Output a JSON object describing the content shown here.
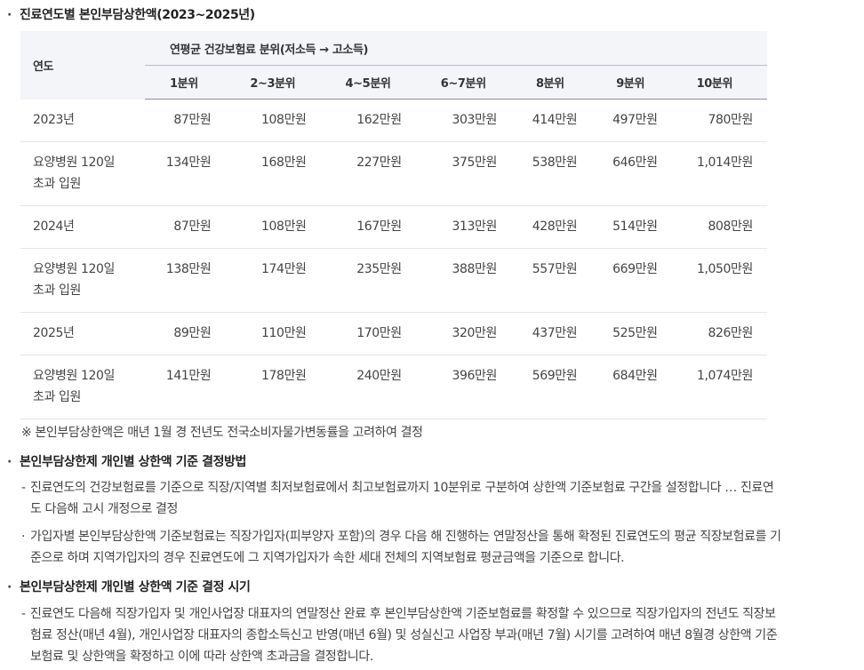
{
  "section1": {
    "bullet": "·",
    "title": "진료연도별 본인부담상한액(2023~2025년)"
  },
  "table": {
    "year_header": "연도",
    "group_header": "연평균 건강보험료 분위(저소득 → 고소득)",
    "columns": [
      "1분위",
      "2~3분위",
      "4~5분위",
      "6~7분위",
      "8분위",
      "9분위",
      "10분위"
    ],
    "rows": [
      {
        "label": [
          "2023년"
        ],
        "values": [
          "87만원",
          "108만원",
          "162만원",
          "303만원",
          "414만원",
          "497만원",
          "780만원"
        ]
      },
      {
        "label": [
          "요양병원 120일",
          "초과 입원"
        ],
        "values": [
          "134만원",
          "168만원",
          "227만원",
          "375만원",
          "538만원",
          "646만원",
          "1,014만원"
        ]
      },
      {
        "label": [
          "2024년"
        ],
        "values": [
          "87만원",
          "108만원",
          "167만원",
          "313만원",
          "428만원",
          "514만원",
          "808만원"
        ]
      },
      {
        "label": [
          "요양병원 120일",
          "초과 입원"
        ],
        "values": [
          "138만원",
          "174만원",
          "235만원",
          "388만원",
          "557만원",
          "669만원",
          "1,050만원"
        ]
      },
      {
        "label": [
          "2025년"
        ],
        "values": [
          "89만원",
          "110만원",
          "170만원",
          "320만원",
          "437만원",
          "525만원",
          "826만원"
        ]
      },
      {
        "label": [
          "요양병원 120일",
          "초과 입원"
        ],
        "values": [
          "141만원",
          "178만원",
          "240만원",
          "396만원",
          "569만원",
          "684만원",
          "1,074만원"
        ]
      }
    ]
  },
  "note": "※ 본인부담상한액은 매년 1월 경 전년도 전국소비자물가변동률을 고려하여 결정",
  "section2": {
    "bullet": "·",
    "title": "본인부담상한제 개인별 상한액 기준 결정방법",
    "para1": {
      "mark": "-",
      "line1": "진료연도의 건강보험료를 기준으로 직장/지역별 최저보험료에서 최고보험료까지 10분위로 구분하여 상한액 기준보험료 구간을 설정합니다 … 진료연",
      "line2": "도 다음해 고시 개정으로 결정"
    },
    "para2": {
      "mark": "·",
      "line1": "가입자별 본인부담상한액 기준보험료는 직장가입자(피부양자 포함)의 경우 다음 해 진행하는 연말정산을 통해 확정된 진료연도의 평균 직장보험료를 기",
      "line2": "준으로 하며 지역가입자의 경우 진료연도에 그 지역가입자가 속한 세대 전체의 지역보험료 평균금액을 기준으로 합니다."
    }
  },
  "section3": {
    "bullet": "·",
    "title": "본인부담상한제 개인별 상한액 기준 결정 시기",
    "para": {
      "mark": "-",
      "line1": "진료연도 다음해 직장가입자 및 개인사업장 대표자의 연말정산 완료 후 본인부담상한액 기준보험료를 확정할 수 있으므로 직장가입자의 전년도 직장보",
      "line2": "험료 정산(매년 4월), 개인사업장 대표자의 종합소득신고 반영(매년 6월) 및 성실신고 사업장 부과(매년 7월) 시기를 고려하여 매년 8월경 상한액 기준",
      "line3": "보험료 및 상한액을 확정하고 이에 따라 상한액 초과금을 결정합니다."
    }
  }
}
